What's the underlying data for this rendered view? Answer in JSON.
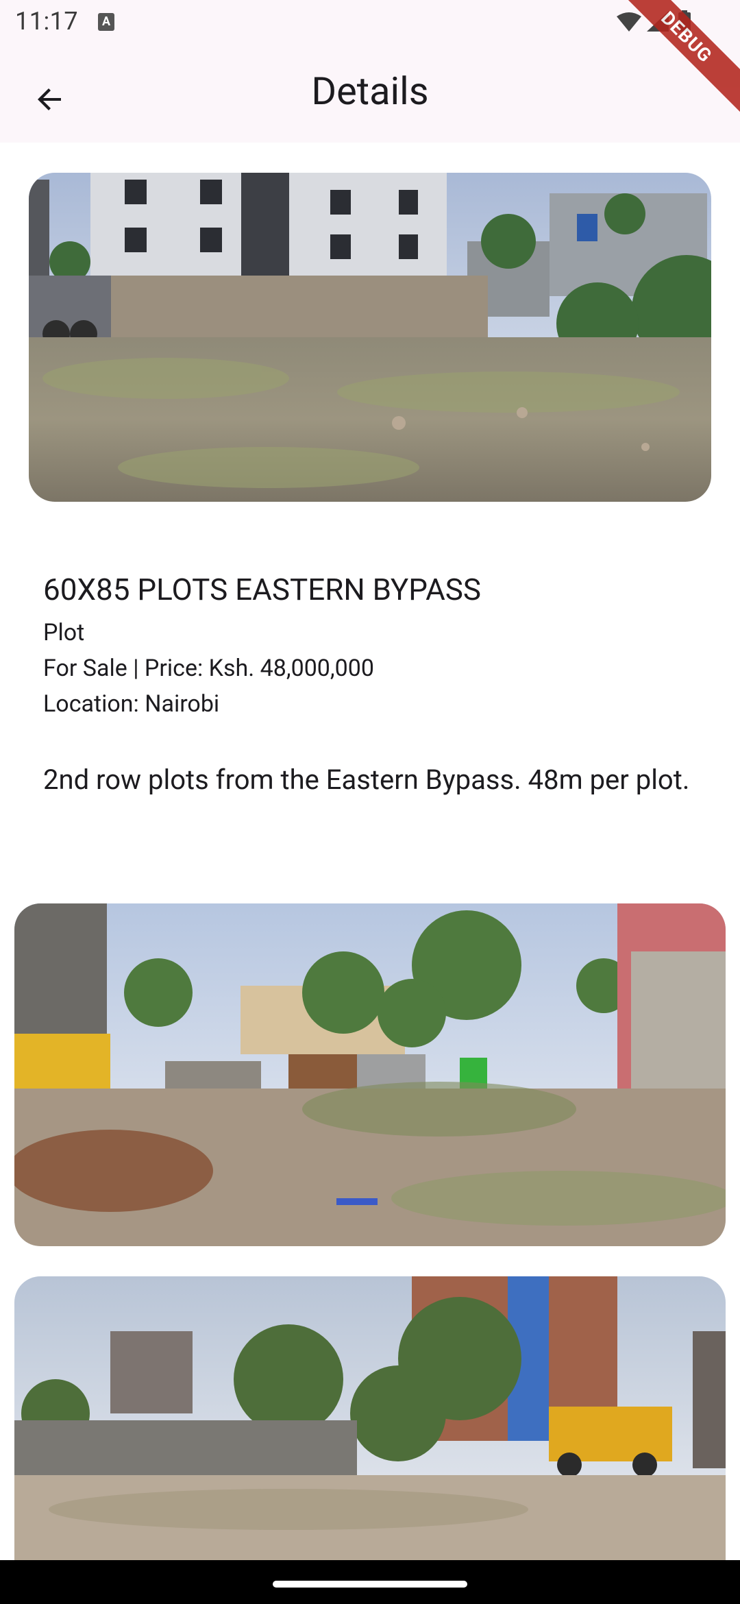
{
  "status_bar": {
    "time": "11:17",
    "notification_icon": "a-icon",
    "icons": [
      "wifi-icon",
      "signal-icon",
      "battery-icon"
    ]
  },
  "app_bar": {
    "title": "Details",
    "back_icon": "arrow-back-icon"
  },
  "debug_banner": "DEBUG",
  "listing": {
    "title": "60X85 PLOTS EASTERN BYPASS",
    "type": "Plot",
    "sale_price": "For Sale | Price: Ksh. 48,000,000",
    "location": "Location: Nairobi",
    "description": "2nd row plots from the Eastern Bypass. 48m per plot."
  },
  "photos": [
    "plot-photo-1",
    "plot-photo-2",
    "plot-photo-3"
  ],
  "colors": {
    "app_bar_bg": "#fcf6fa",
    "debug_ribbon": "#b3261e",
    "nav_bar": "#000000"
  }
}
